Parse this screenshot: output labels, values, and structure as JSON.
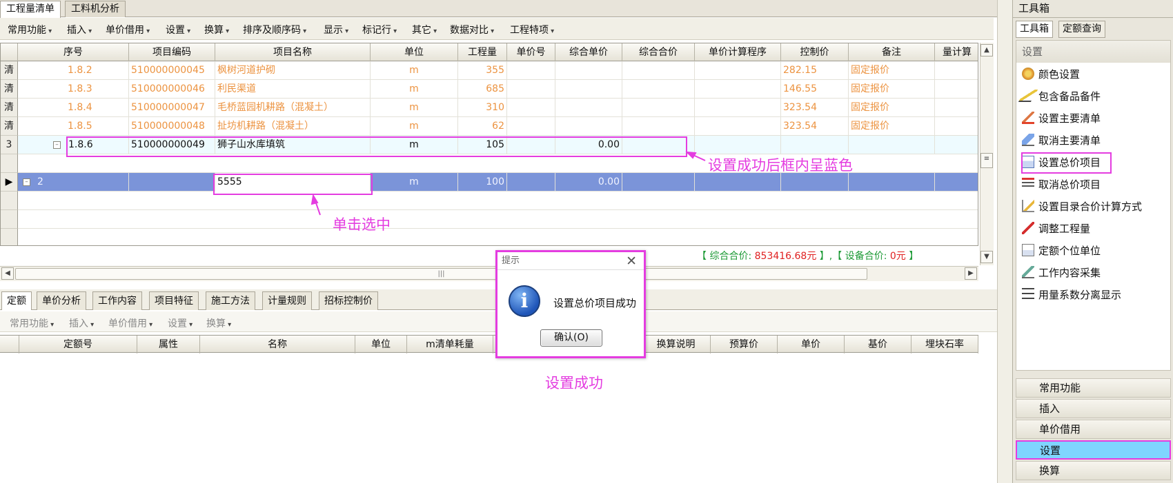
{
  "tabs": [
    "工程量清单",
    "工料机分析"
  ],
  "toolbar": [
    "常用功能",
    "插入",
    "单价借用",
    "设置",
    "换算",
    "排序及顺序码",
    "显示",
    "标记行",
    "其它",
    "数据对比",
    "工程特项"
  ],
  "grid": {
    "headers": [
      "序号",
      "项目编码",
      "项目名称",
      "单位",
      "工程量",
      "单价号",
      "综合单价",
      "综合合价",
      "单价计算程序",
      "控制价",
      "备注",
      "量计算"
    ],
    "rows": [
      {
        "rowhead": "清",
        "seq": "1.8.2",
        "code": "510000000045",
        "name": "枫树河道护砌",
        "unit": "m",
        "qty": "355",
        "price": "",
        "total": "",
        "ctrl": "282.15",
        "note": "固定报价"
      },
      {
        "rowhead": "清",
        "seq": "1.8.3",
        "code": "510000000046",
        "name": "利民渠道",
        "unit": "m",
        "qty": "685",
        "price": "",
        "total": "",
        "ctrl": "146.55",
        "note": "固定报价"
      },
      {
        "rowhead": "清",
        "seq": "1.8.4",
        "code": "510000000047",
        "name": "毛桥蓝园机耕路（混凝土）",
        "unit": "m",
        "qty": "310",
        "price": "",
        "total": "",
        "ctrl": "323.54",
        "note": "固定报价"
      },
      {
        "rowhead": "清",
        "seq": "1.8.5",
        "code": "510000000048",
        "name": "扯坊机耕路（混凝土）",
        "unit": "m",
        "qty": "62",
        "price": "",
        "total": "",
        "ctrl": "323.54",
        "note": "固定报价"
      },
      {
        "rowhead": "3",
        "seq": "1.8.6",
        "code": "510000000049",
        "name": "狮子山水库填筑",
        "unit": "m",
        "qty": "105",
        "price": "0.00",
        "total": "",
        "ctrl": "",
        "note": ""
      },
      {
        "rowhead": "",
        "seq": "2",
        "code": "",
        "name": "5555",
        "unit": "m",
        "qty": "100",
        "price": "0.00",
        "total": "",
        "ctrl": "",
        "note": ""
      }
    ],
    "summary_prefix": "【 综合合价: ",
    "summary_total": "853416.68元",
    "summary_mid": " 】,【 设备合价: ",
    "summary_equipment": "0元",
    "summary_suffix": " 】"
  },
  "annotations": {
    "blue_frame": "设置成功后框内呈蓝色",
    "click_select": "单击选中",
    "success": "设置成功"
  },
  "bottom": {
    "tabs": [
      "定额",
      "单价分析",
      "工作内容",
      "项目特征",
      "施工方法",
      "计量规则",
      "招标控制价"
    ],
    "toolbar": [
      "常用功能",
      "插入",
      "单价借用",
      "设置",
      "换算"
    ],
    "headers": [
      "定额号",
      "属性",
      "名称",
      "单位",
      "m清单耗量",
      "换算说明",
      "预算价",
      "单价",
      "基价",
      "埋块石率"
    ]
  },
  "dialog": {
    "title": "提示",
    "message": "设置总价项目成功",
    "button": "确认(O)"
  },
  "toolbox": {
    "title": "工具箱",
    "tabs": [
      "工具箱",
      "定额查询"
    ],
    "section": "设置",
    "items": [
      "颜色设置",
      "包含备品备件",
      "设置主要清单",
      "取消主要清单",
      "设置总价项目",
      "取消总价项目",
      "设置目录合价计算方式",
      "调整工程量",
      "定额个位单位",
      "工作内容采集",
      "用量系数分离显示"
    ],
    "categories": [
      "常用功能",
      "插入",
      "单价借用",
      "设置",
      "换算"
    ]
  },
  "colors": {
    "accent": "#e43ce0",
    "selected_row": "#7b94d9",
    "orange_text": "#ec9340",
    "summary_green": "#1d9a36"
  }
}
